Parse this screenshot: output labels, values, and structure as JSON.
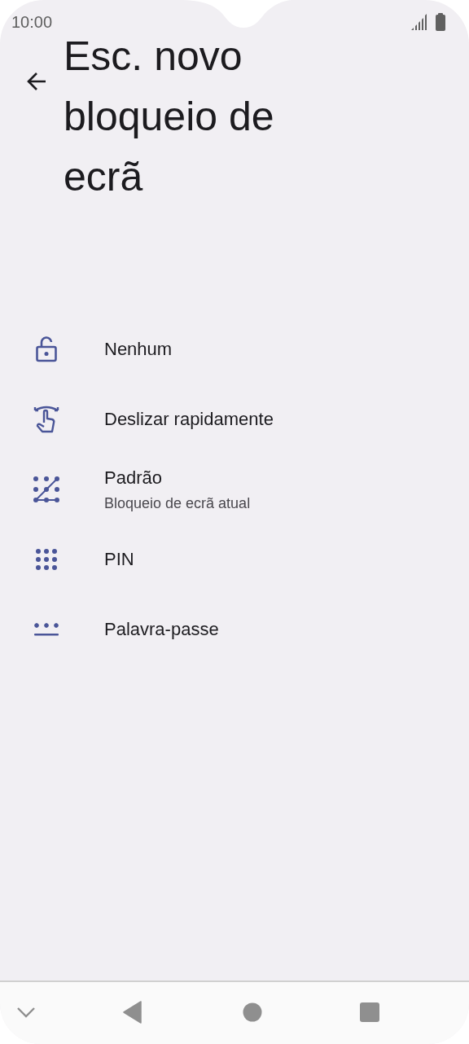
{
  "status_bar": {
    "time": "10:00"
  },
  "header": {
    "title": "Esc. novo bloqueio de ecrã"
  },
  "options": [
    {
      "kind": "lock",
      "label": "Nenhum"
    },
    {
      "kind": "swipe",
      "label": "Deslizar rapidamente"
    },
    {
      "kind": "pattern",
      "label": "Padrão",
      "subtitle": "Bloqueio de ecrã atual"
    },
    {
      "kind": "pin",
      "label": "PIN"
    },
    {
      "kind": "password",
      "label": "Palavra-passe"
    }
  ]
}
